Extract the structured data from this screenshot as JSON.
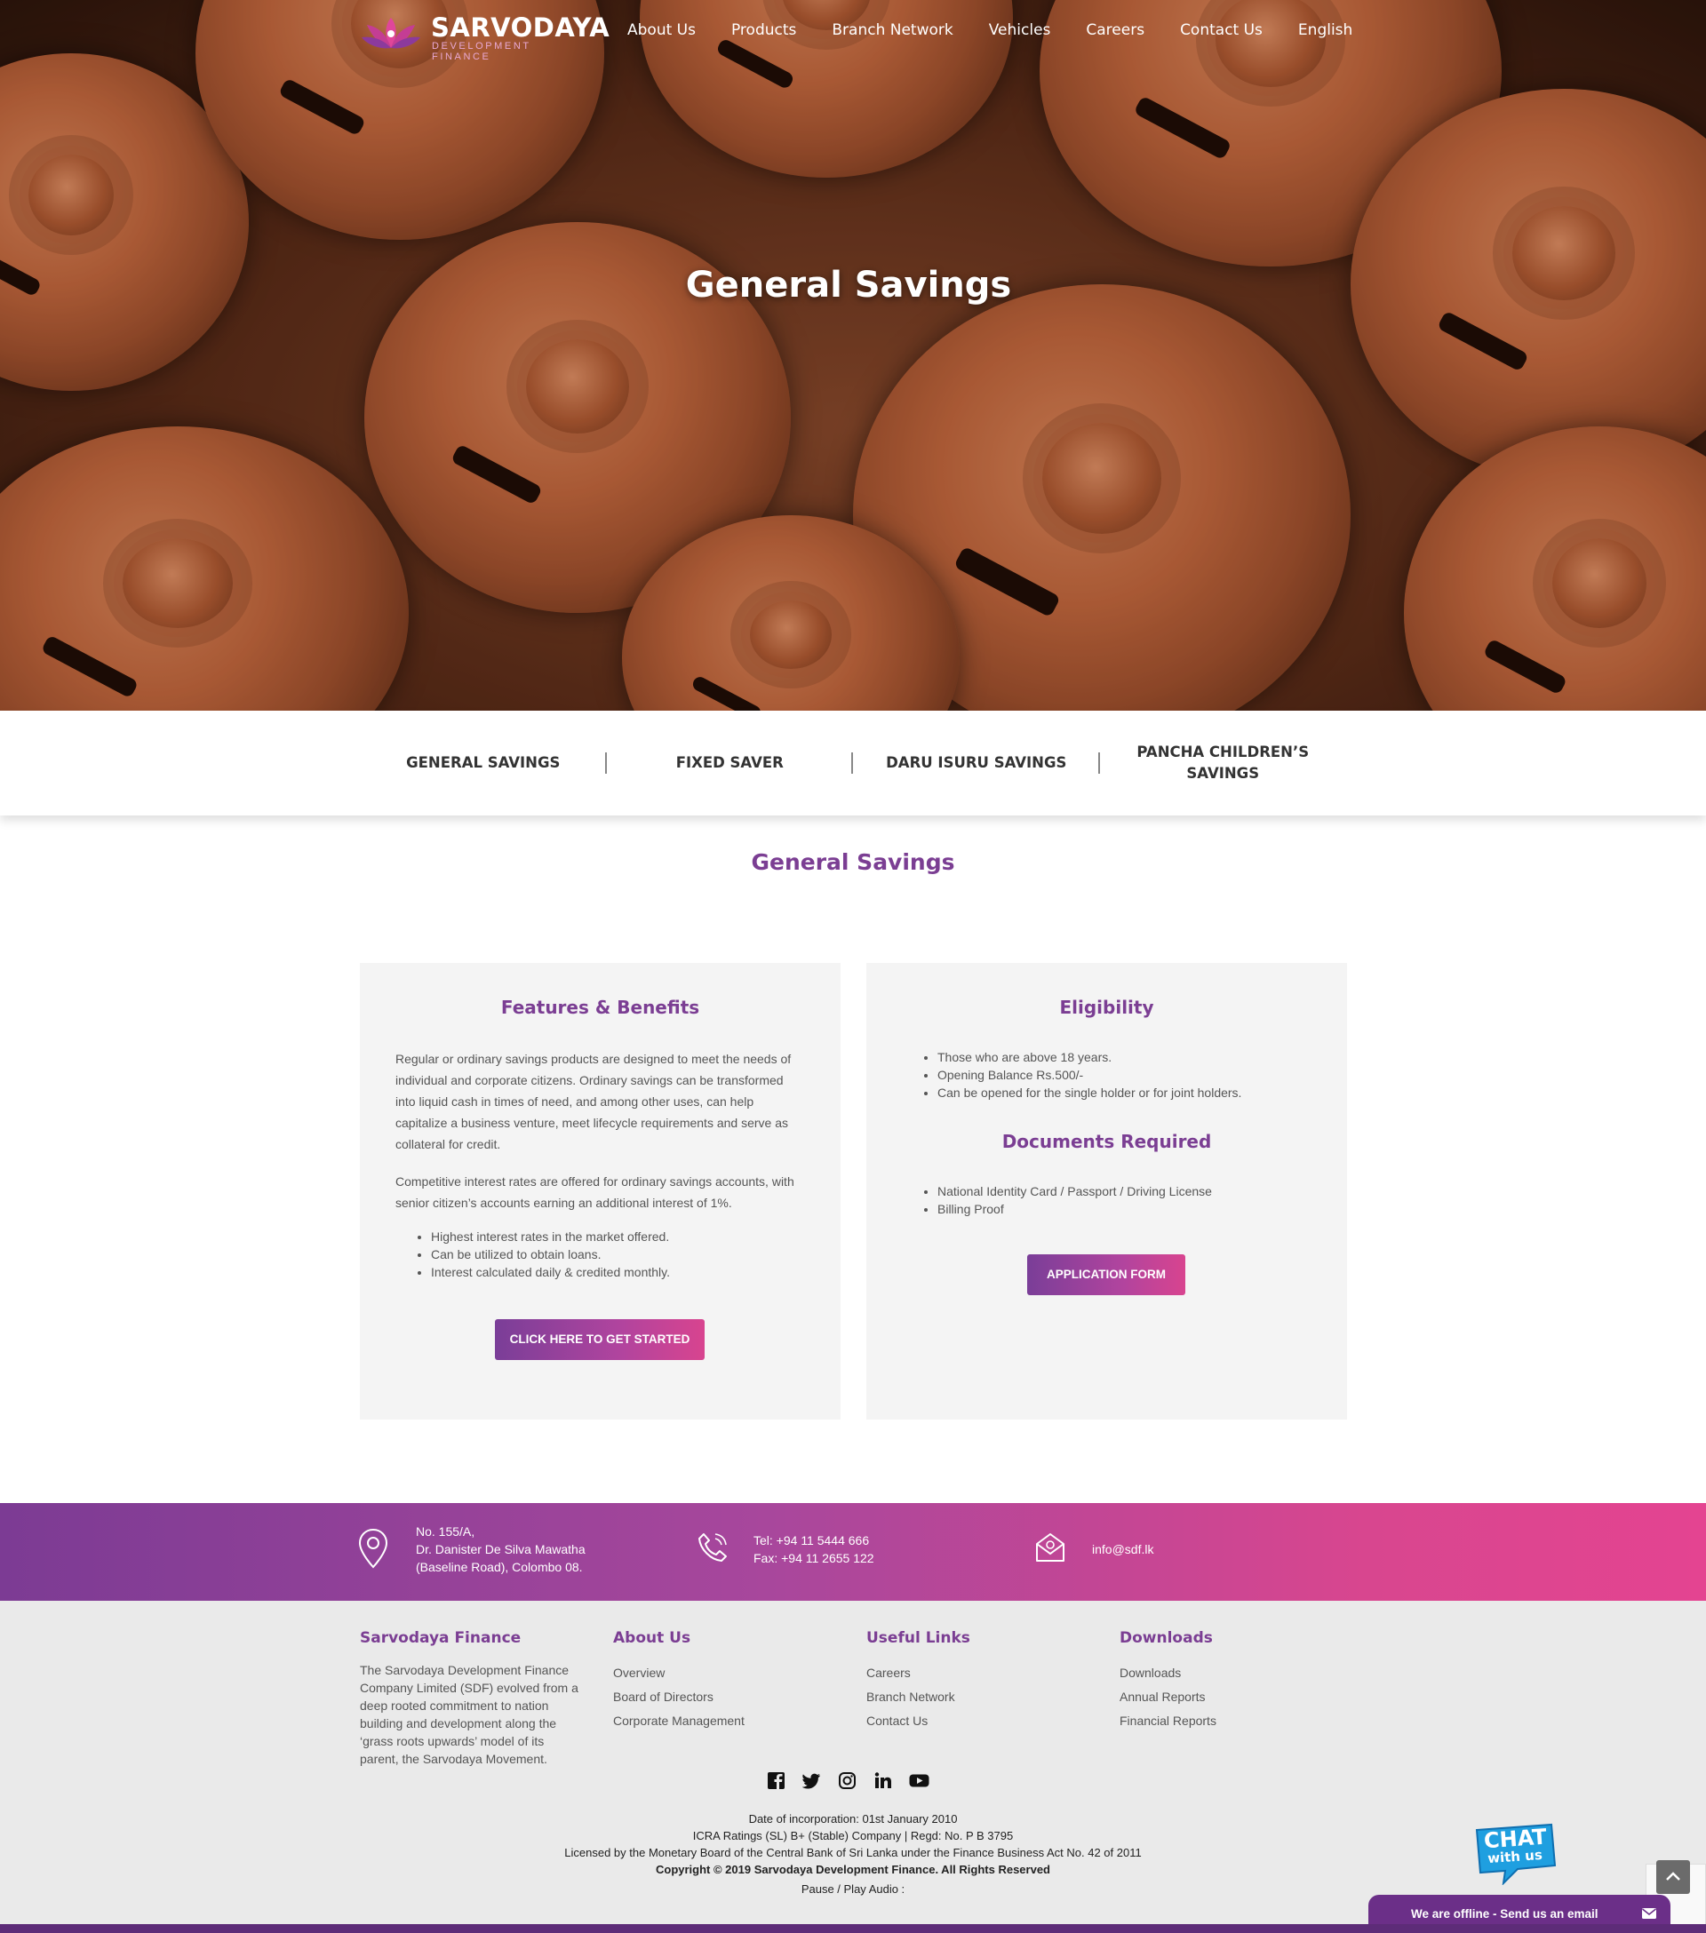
{
  "brand": {
    "name": "SARVODAYA",
    "tagline": "DEVELOPMENT FINANCE"
  },
  "nav": [
    "About Us",
    "Products",
    "Branch Network",
    "Vehicles",
    "Careers",
    "Contact Us",
    "English"
  ],
  "hero": {
    "title": "General Savings"
  },
  "tabs": [
    {
      "label": "GENERAL SAVINGS"
    },
    {
      "label": "FIXED SAVER"
    },
    {
      "label": "DARU ISURU SAVINGS"
    },
    {
      "label": "PANCHA CHILDREN’S SAVINGS"
    }
  ],
  "section": {
    "title": "General Savings"
  },
  "features": {
    "heading": "Features & Benefits",
    "para1": "Regular or ordinary savings products are designed to meet the needs of individual and corporate citizens. Ordinary savings can be transformed into liquid cash in times of need, and among other uses, can help capitalize a business venture, meet lifecycle requirements and serve as collateral for credit.",
    "para2": "Competitive interest rates are offered for ordinary savings accounts, with senior citizen’s accounts earning an additional interest of 1%.",
    "bullets": [
      "Highest interest rates in the market offered.",
      "Can be utilized to obtain loans.",
      "Interest calculated daily & credited monthly."
    ],
    "button": "CLICK HERE TO GET STARTED"
  },
  "eligibility": {
    "heading": "Eligibility",
    "bullets": [
      "Those who are above 18 years.",
      "Opening Balance Rs.500/-",
      "Can be opened for the single holder or for joint holders."
    ]
  },
  "documents": {
    "heading": "Documents Required",
    "bullets": [
      "National Identity Card / Passport / Driving License",
      "Billing Proof"
    ],
    "button": "APPLICATION FORM"
  },
  "contact": {
    "address": [
      "No. 155/A,",
      "Dr. Danister De Silva Mawatha",
      "(Baseline Road), Colombo 08."
    ],
    "phone": [
      "Tel: +94 11 5444 666",
      "Fax: +94 11 2655 122"
    ],
    "email": "info@sdf.lk"
  },
  "footer": {
    "about": {
      "heading": "Sarvodaya Finance",
      "text": "The Sarvodaya Development Finance Company Limited (SDF) evolved from a deep rooted commitment to nation building and development along the ‘grass roots upwards’ model of its parent, the Sarvodaya Movement."
    },
    "columns": [
      {
        "heading": "About Us",
        "links": [
          "Overview",
          "Board of Directors",
          "Corporate Management"
        ]
      },
      {
        "heading": "Useful Links",
        "links": [
          "Careers",
          "Branch Network",
          "Contact Us"
        ]
      },
      {
        "heading": "Downloads",
        "links": [
          "Downloads",
          "Annual Reports",
          "Financial Reports"
        ]
      }
    ],
    "socials": [
      "facebook-icon",
      "twitter-icon",
      "instagram-icon",
      "linkedin-icon",
      "youtube-icon"
    ],
    "fine": [
      "Date of incorporation: 01st January 2010",
      "ICRA Ratings (SL) B+ (Stable) Company | Regd: No. P B 3795",
      "Licensed by the Monetary Board of the Central Bank of Sri Lanka under the Finance Business Act No. 42 of 2011",
      "Copyright © 2019 Sarvodaya Development Finance. All Rights Reserved",
      "Pause / Play Audio :"
    ]
  },
  "chat": {
    "badge_line1": "CHAT",
    "badge_line2": "with us",
    "offline": "We are offline - Send us an email"
  },
  "colors": {
    "purple": "#7b3e93",
    "pink": "#d8448f"
  }
}
